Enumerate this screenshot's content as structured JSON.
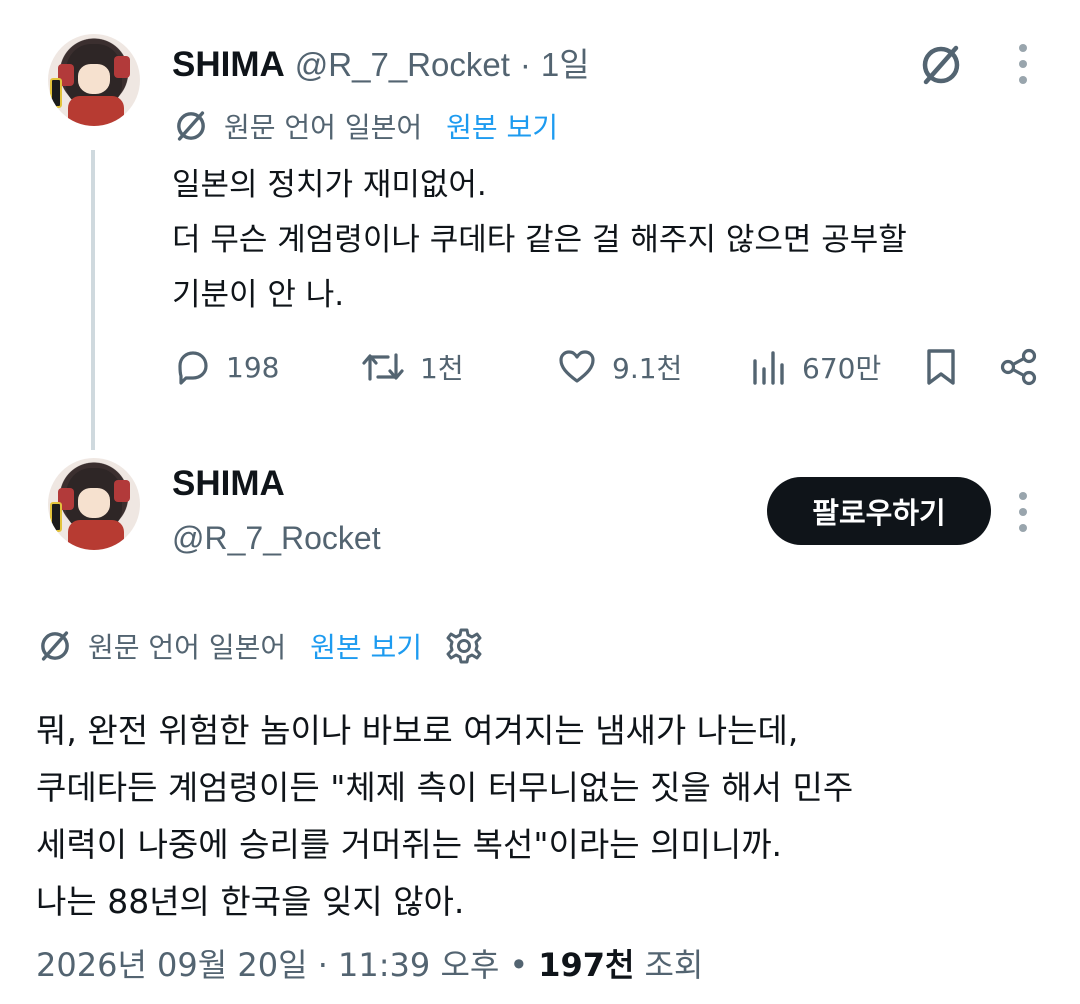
{
  "tweet1": {
    "name": "SHIMA",
    "handle": "@R_7_Rocket",
    "separator": "·",
    "time": "1일",
    "translation": {
      "text": "원문 언어 일본어",
      "link": "원본 보기"
    },
    "lines": [
      "일본의 정치가 재미없어.",
      "더 무슨 계엄령이나 쿠데타 같은 걸 해주지 않으면 공부할",
      "기분이 안 나."
    ],
    "stats": {
      "replies": "198",
      "retweets": "1천",
      "likes": "9.1천",
      "views": "670만"
    }
  },
  "tweet2": {
    "name": "SHIMA",
    "handle": "@R_7_Rocket",
    "follow_label": "팔로우하기",
    "translation": {
      "text": "원문 언어 일본어",
      "link": "원본 보기"
    },
    "lines": [
      "뭐, 완전 위험한 놈이나 바보로 여겨지는 냄새가 나는데,",
      "쿠데타든 계엄령이든 \"체제 측이 터무니없는 짓을 해서 민주",
      "세력이 나중에 승리를 거머쥐는 복선\"이라는 의미니까.",
      "나는 88년의 한국을 잊지 않아."
    ],
    "meta": {
      "datetime": "2026년 09월 20일 · 11:39 오후",
      "bullet": "•",
      "views": "197천",
      "views_label": "조회"
    }
  },
  "icons": {
    "translate": "translate-icon",
    "more": "more-dots-icon",
    "reply": "reply-icon",
    "retweet": "retweet-icon",
    "like": "heart-icon",
    "views": "views-bar-icon",
    "bookmark": "bookmark-icon",
    "share": "share-icon",
    "settings": "gear-icon"
  },
  "colors": {
    "text": "#0f1419",
    "secondary": "#536471",
    "link": "#1d9bf0",
    "button": "#0f1419",
    "thread_line": "#cfd9de"
  }
}
